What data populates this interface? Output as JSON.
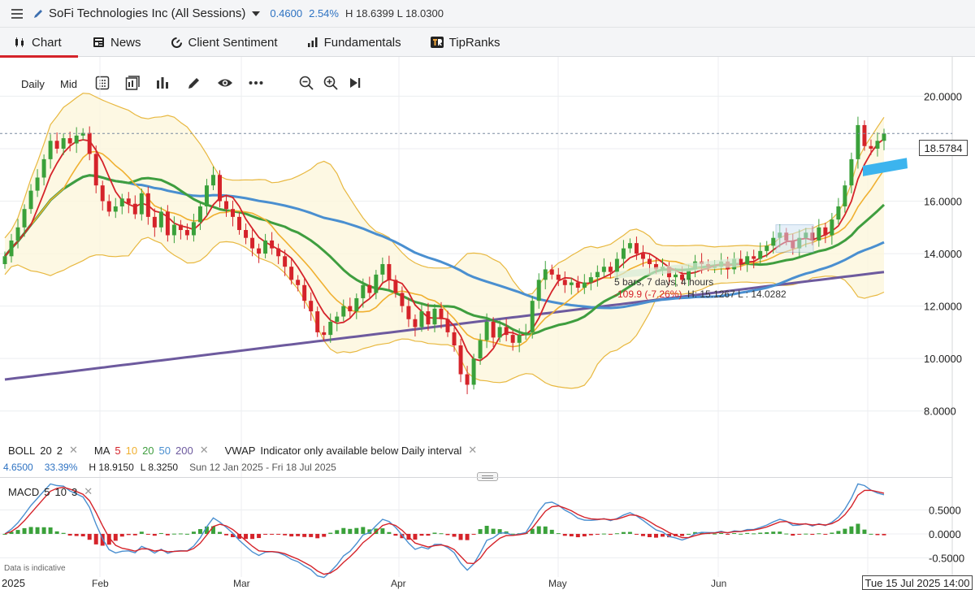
{
  "header": {
    "title": "SoFi Technologies Inc (All Sessions)",
    "change": "0.4600",
    "change_pct": "2.54%",
    "high_low": "H 18.6399 L 18.0300"
  },
  "tabs": [
    {
      "label": "Chart",
      "icon": "candlestick-icon",
      "active": true
    },
    {
      "label": "News",
      "icon": "newspaper-icon"
    },
    {
      "label": "Client Sentiment",
      "icon": "sentiment-gauge-icon"
    },
    {
      "label": "Fundamentals",
      "icon": "bar-chart-icon"
    },
    {
      "label": "TipRanks",
      "icon": "tipranks-logo-icon"
    }
  ],
  "toolbar": {
    "interval_daily": "Daily",
    "price_mid": "Mid",
    "icons": [
      "calculator-icon",
      "template-icon",
      "chart-type-icon",
      "pencil-icon",
      "eye-icon",
      "more-icon",
      "zoom-out-icon",
      "zoom-in-icon",
      "skip-to-end-icon"
    ]
  },
  "indicators": {
    "boll": {
      "name": "BOLL",
      "p1": "20",
      "p2": "2"
    },
    "ma": {
      "name": "MA",
      "periods": [
        "5",
        "10",
        "20",
        "50",
        "200"
      ],
      "colors": [
        "#d5232a",
        "#f0b030",
        "#3f9e3f",
        "#4a8fd0",
        "#6d5a9e"
      ]
    },
    "vwap": {
      "name": "VWAP",
      "note": "Indicator only available below Daily interval"
    },
    "macd": {
      "name": "MACD",
      "p1": "5",
      "p2": "10",
      "p3": "3"
    }
  },
  "range_info": {
    "change": "4.6500",
    "change_pct": "33.39%",
    "high": "H 18.9150",
    "low": "L 8.3250",
    "dates": "Sun 12 Jan 2025 - Fri 18 Jul 2025"
  },
  "measure_tooltip": {
    "line1": "5 bars, 7 days, 4 hours",
    "line2": "-109.9 (-7.26%)",
    "line3": "H: 15.1267 L : 14.0282"
  },
  "current_price": "18.5784",
  "crosshair_date": "Tue 15 Jul 2025 14:00",
  "disclaimer": "Data is indicative",
  "chart_data": {
    "type": "candlestick",
    "ylim": [
      7.0,
      21.5
    ],
    "y_ticks": [
      "20.0000",
      "18.0000",
      "16.0000",
      "14.0000",
      "12.0000",
      "10.0000",
      "8.0000"
    ],
    "y_tick_values": [
      20,
      18,
      16,
      14,
      12,
      10,
      8
    ],
    "x_labels": [
      {
        "label": "2025",
        "date": "2025-01-01"
      },
      {
        "label": "Feb",
        "date": "2025-02-01"
      },
      {
        "label": "Mar",
        "date": "2025-03-01"
      },
      {
        "label": "Apr",
        "date": "2025-04-01"
      },
      {
        "label": "May",
        "date": "2025-05-01"
      },
      {
        "label": "Jun",
        "date": "2025-06-01"
      }
    ],
    "closes": [
      13.9,
      14.5,
      15.0,
      15.7,
      16.4,
      16.9,
      17.6,
      18.3,
      18.0,
      18.4,
      18.2,
      18.5,
      18.6,
      17.8,
      16.6,
      16.0,
      15.6,
      15.8,
      16.1,
      15.9,
      15.5,
      16.3,
      15.4,
      15.0,
      15.6,
      14.7,
      15.1,
      14.9,
      14.7,
      15.2,
      15.8,
      16.6,
      17.0,
      16.0,
      15.7,
      15.4,
      14.9,
      14.6,
      14.2,
      14.0,
      14.5,
      14.2,
      13.9,
      13.5,
      13.0,
      12.8,
      12.2,
      11.8,
      11.0,
      10.9,
      11.4,
      11.6,
      12.0,
      11.8,
      12.3,
      12.8,
      12.5,
      13.2,
      13.6,
      13.0,
      12.5,
      12.0,
      11.5,
      11.2,
      11.8,
      11.3,
      11.9,
      11.5,
      11.0,
      10.5,
      9.4,
      9.0,
      10.0,
      10.7,
      11.4,
      10.8,
      11.2,
      10.9,
      10.6,
      10.9,
      11.0,
      12.2,
      13.0,
      13.4,
      13.2,
      13.0,
      12.8,
      12.9,
      12.7,
      12.9,
      13.1,
      13.3,
      13.5,
      13.3,
      13.8,
      14.2,
      14.4,
      14.0,
      13.8,
      13.6,
      13.4,
      13.5,
      13.1,
      13.2,
      13.0,
      13.4,
      13.7,
      13.6,
      13.5,
      13.5,
      13.7,
      13.4,
      13.8,
      13.6,
      13.9,
      13.8,
      14.1,
      14.3,
      14.6,
      14.8,
      14.5,
      14.2,
      14.6,
      14.8,
      14.5,
      15.0,
      14.7,
      15.3,
      15.8,
      16.6,
      17.6,
      18.9,
      18.1,
      18.0,
      18.3,
      18.58
    ],
    "high": "18.9150",
    "low": "8.3250",
    "macd_ylim": [
      -0.9,
      1.0
    ],
    "macd_ticks": [
      "0.5000",
      "0.0000",
      "-0.5000"
    ],
    "macd_tick_values": [
      0.5,
      0.0,
      -0.5
    ]
  }
}
